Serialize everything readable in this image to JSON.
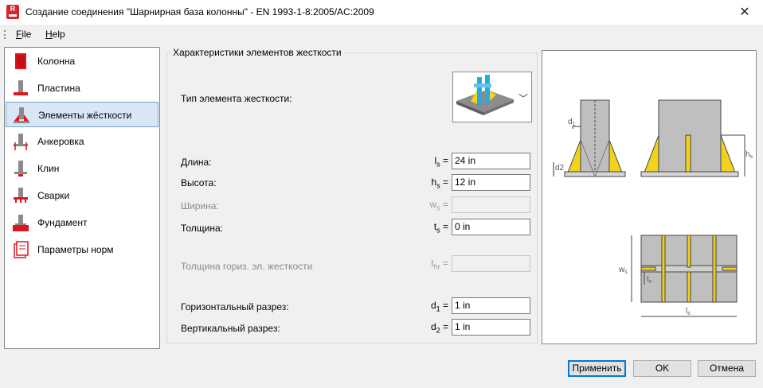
{
  "window": {
    "title": "Создание соединения \"Шарнирная база колонны\" - EN 1993-1-8:2005/AC:2009",
    "app_icon_letter": "R"
  },
  "menu": {
    "items": [
      {
        "hotkey": "F",
        "rest": "ile"
      },
      {
        "hotkey": "H",
        "rest": "elp"
      }
    ]
  },
  "sidebar": {
    "items": [
      {
        "label": "Колонна",
        "icon": "column-icon"
      },
      {
        "label": "Пластина",
        "icon": "plate-icon"
      },
      {
        "label": "Элементы жёсткости",
        "icon": "stiffeners-icon",
        "selected": true
      },
      {
        "label": "Анкеровка",
        "icon": "anchorage-icon"
      },
      {
        "label": "Клин",
        "icon": "wedge-icon"
      },
      {
        "label": "Сварки",
        "icon": "welds-icon"
      },
      {
        "label": "Фундамент",
        "icon": "foundation-icon"
      },
      {
        "label": "Параметры норм",
        "icon": "code-parameters-icon"
      }
    ]
  },
  "stiffeners": {
    "group_title": "Характеристики элементов жесткости",
    "type_label": "Тип элемента жесткости:",
    "length": {
      "label": "Длина:",
      "sym": "l",
      "sub": "s",
      "value": "24 in"
    },
    "height": {
      "label": "Высота:",
      "sym": "h",
      "sub": "s",
      "value": "12 in"
    },
    "width": {
      "label": "Ширина:",
      "sym": "w",
      "sub": "s",
      "value": ""
    },
    "thickness": {
      "label": "Толщина:",
      "sym": "t",
      "sub": "s",
      "value": "0 in"
    },
    "horiz_thickness": {
      "label": "Толщина гориз. эл. жесткости",
      "sym": "t",
      "sub": "hr",
      "value": ""
    },
    "horiz_cut": {
      "label": "Горизонтальный разрез:",
      "sym": "d",
      "sub": "1",
      "value": "1 in"
    },
    "vert_cut": {
      "label": "Вертикальный разрез:",
      "sym": "d",
      "sub": "2",
      "value": "1 in"
    }
  },
  "diagram": {
    "d1": "d",
    "d1_sub": "1",
    "d2": "d2",
    "hs": "h",
    "ws": "w",
    "ts": "t",
    "ls": "l",
    "sub_s": "s"
  },
  "buttons": {
    "apply": "Применить",
    "ok": "OK",
    "cancel": "Отмена"
  },
  "colors": {
    "accent": "#0078d7",
    "stiffener_fill": "#f2d21e",
    "red": "#e0161e",
    "selection": "#d8e6f5"
  }
}
